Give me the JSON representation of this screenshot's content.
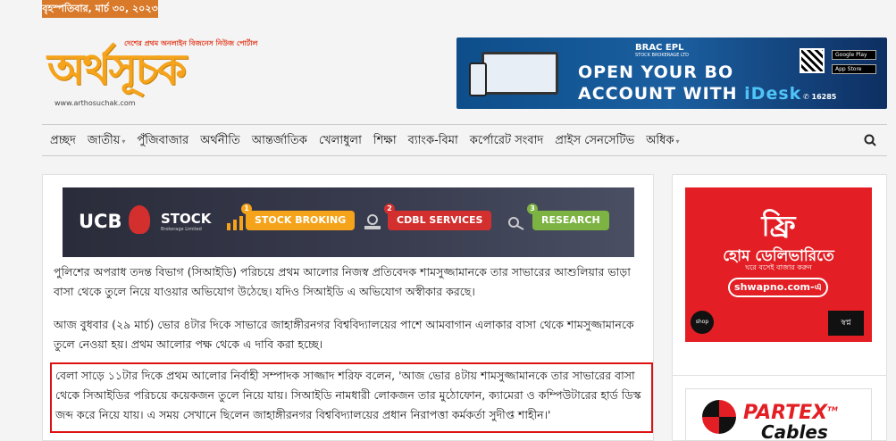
{
  "topbar": {
    "date": "বৃহস্পতিবার, মার্চ ৩০, ২০২৩"
  },
  "logo": {
    "tagline": "দেশের প্রথম অনলাইন বিজনেস নিউজ পোর্টাল",
    "wordmark": "অর্থসূচক",
    "url": "www.arthosuchak.com"
  },
  "header_ad": {
    "brand": "BRAC EPL",
    "brand_sub": "STOCK BROKERAGE LTD",
    "line1": "OPEN YOUR BO",
    "line2_prefix": "ACCOUNT WITH ",
    "line2_highlight": "iDesk",
    "store1": "Google Play",
    "store2": "App Store",
    "hotline": "16285",
    "colors": {
      "bg": "#0d4e8a",
      "highlight": "#4fc3f7"
    }
  },
  "nav": {
    "items": [
      {
        "label": "প্রচ্ছদ",
        "dropdown": false
      },
      {
        "label": "জাতীয়",
        "dropdown": true
      },
      {
        "label": "পুঁজিবাজার",
        "dropdown": false
      },
      {
        "label": "অর্থনীতি",
        "dropdown": false
      },
      {
        "label": "আন্তর্জাতিক",
        "dropdown": false
      },
      {
        "label": "খেলাধুলা",
        "dropdown": false
      },
      {
        "label": "শিক্ষা",
        "dropdown": false
      },
      {
        "label": "ব্যাংক-বিমা",
        "dropdown": false
      },
      {
        "label": "কর্পোরেট সংবাদ",
        "dropdown": false
      },
      {
        "label": "প্রাইস সেনসেটিভ",
        "dropdown": false
      },
      {
        "label": "অধিক",
        "dropdown": true
      }
    ],
    "search_icon": "search-icon"
  },
  "content_ad": {
    "brand": "UCB",
    "stock": "STOCK",
    "stock_sub": "Brokerage Limited",
    "services": [
      {
        "num": "1",
        "label": "STOCK BROKING",
        "color": "#f5a31a"
      },
      {
        "num": "2",
        "label": "CDBL SERVICES",
        "color": "#d32f2f"
      },
      {
        "num": "3",
        "label": "RESEARCH",
        "color": "#7cb342"
      }
    ]
  },
  "article": {
    "p1": "পুলিশের অপরাধ তদন্ত বিভাগ (সিআইডি) পরিচয়ে প্রথম আলোর নিজস্ব প্রতিবেদক শামসুজ্জামানকে তার সাভারের আশুলিয়ার ভাড়া বাসা থেকে তুলে নিয়ে যাওয়ার অভিযোগ উঠেছে। যদিও সিআইডি এ অভিযোগ অস্বীকার করছে।",
    "p2": "আজ বুধবার (২৯ মার্চ) ভোর ৪টার দিকে সাভারে জাহাঙ্গীরনগর বিশ্ববিদ্যালয়ের পাশে আমবাগান এলাকার বাসা থেকে শামসুজ্জামানকে তুলে নেওয়া হয়। প্রথম আলোর পক্ষ থেকে এ দাবি করা হচ্ছে।",
    "p3": "বেলা সাড়ে ১১টার দিকে প্রথম আলোর নির্বাহী সম্পাদক সাজ্জাদ শরিফ বলেন, 'আজ ভোর ৪টায় শামসুজ্জামানকে তার সাভারের বাসা থেকে সিআইডির পরিচয়ে কয়েকজন তুলে নিয়ে যায়। সিআইডি নামধারী লোকজন তার মুঠোফোন, ক্যামেরা ও কম্পিউটারের হার্ড ডিস্ক জব্দ করে নিয়ে যায়। এ সময় সেখানে ছিলেন জাহাঙ্গীরনগর বিশ্ববিদ্যালয়ের প্রধান নিরাপত্তা কর্মকর্তা সুদীপ্ত শাহীন।'"
  },
  "sidebar_ad1": {
    "free": "ফ্রি",
    "home_delivery": "হোম ডেলিভারিতে",
    "sub": "ঘরে বসেই বাজার করুন",
    "url": "shwapno.com-এ",
    "shop_badge": "shop now",
    "brand": "স্বপ্ন",
    "color": "#e31e24"
  },
  "sidebar_ad2": {
    "brand": "PARTEX",
    "product": "Cables",
    "tm": "TM"
  }
}
